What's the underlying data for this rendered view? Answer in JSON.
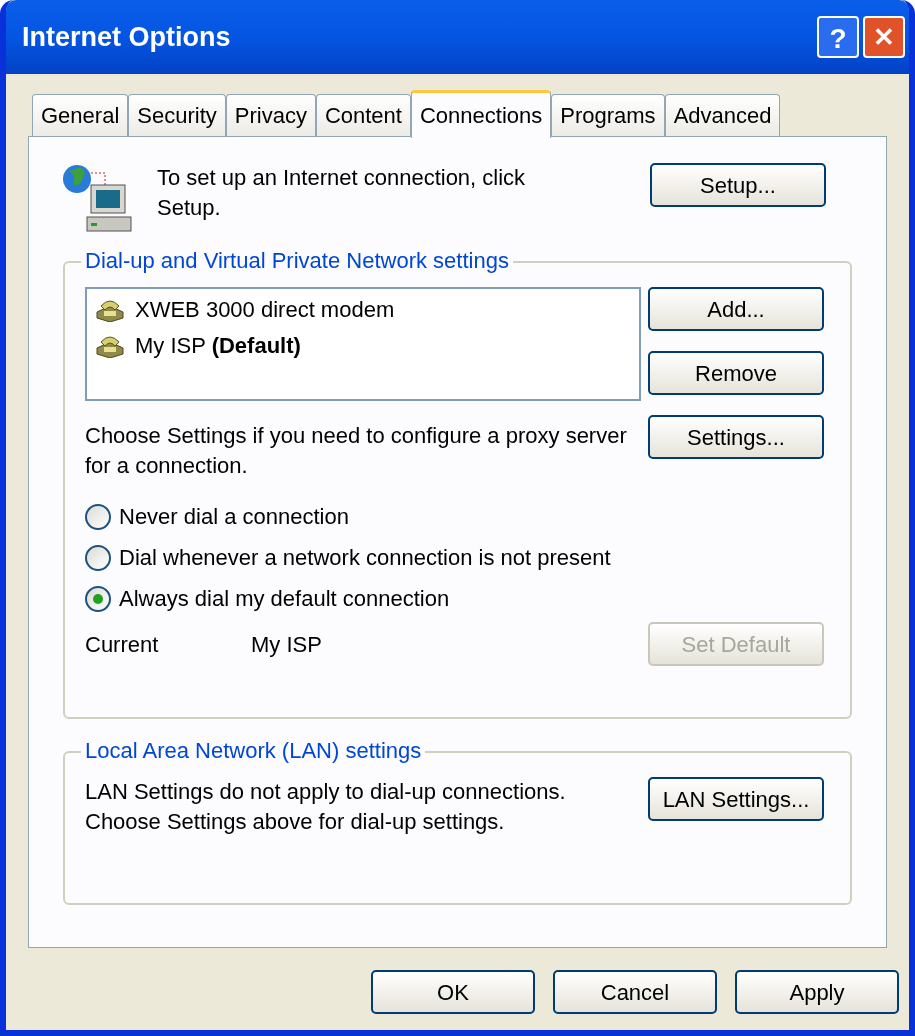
{
  "window": {
    "title": "Internet Options",
    "title_buttons": [
      "?",
      "✕"
    ]
  },
  "tabs": [
    {
      "label": "General",
      "selected": false
    },
    {
      "label": "Security",
      "selected": false
    },
    {
      "label": "Privacy",
      "selected": false
    },
    {
      "label": "Content",
      "selected": false
    },
    {
      "label": "Connections",
      "selected": true
    },
    {
      "label": "Programs",
      "selected": false
    },
    {
      "label": "Advanced",
      "selected": false
    }
  ],
  "setup": {
    "text": "To set up an Internet connection, click Setup.",
    "button": "Setup..."
  },
  "dialup": {
    "legend": "Dial-up and Virtual Private Network settings",
    "connections": [
      {
        "name": "XWEB 3000 direct modem"
      },
      {
        "name": "My ISP **(Default)**"
      }
    ],
    "buttons": [
      {
        "label": "Add...",
        "disabled": false
      },
      {
        "label": "Remove",
        "disabled": false
      }
    ],
    "proxy_text": "Choose Settings if you need to configure a proxy server for a connection.",
    "settings_button": "Settings...",
    "options": [
      {
        "label": "Never dial a connection",
        "selected": false
      },
      {
        "label": "Dial whenever a network connection is not present",
        "selected": false
      },
      {
        "label": "Always dial my default connection",
        "selected": true
      }
    ],
    "current_label": "Current",
    "current_value": "My ISP",
    "set_default": {
      "label": "Set Default",
      "disabled": true
    }
  },
  "lan": {
    "legend": "Local Area Network (LAN) settings",
    "text": "LAN Settings do not apply to dial-up connections. Choose Settings above for dial-up settings.",
    "button": "LAN Settings..."
  },
  "footer_buttons": [
    "OK",
    "Cancel",
    "Apply"
  ]
}
